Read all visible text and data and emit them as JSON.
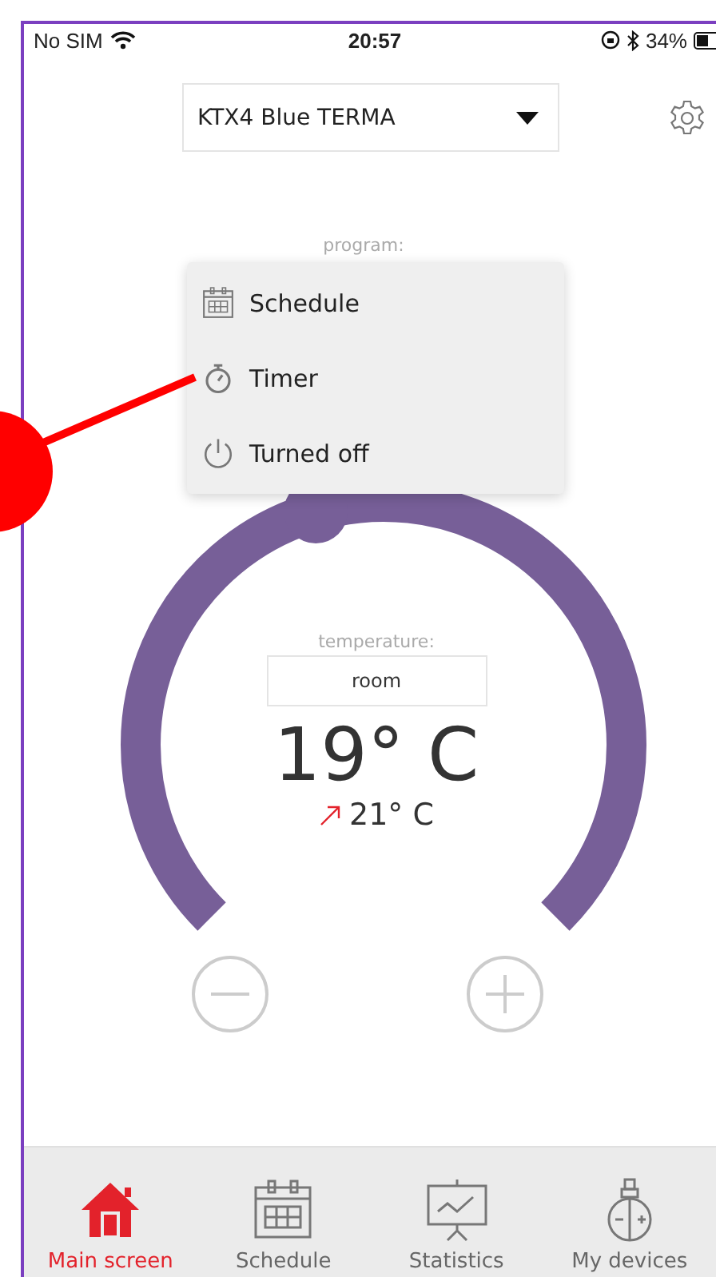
{
  "status_bar": {
    "carrier": "No SIM",
    "time": "20:57",
    "battery": "34%"
  },
  "device_select": {
    "value": "KTX4 Blue TERMA"
  },
  "program": {
    "label": "program:",
    "menu": [
      {
        "label": "Schedule",
        "kind": "schedule"
      },
      {
        "label": "Timer",
        "kind": "timer"
      },
      {
        "label": "Turned off",
        "kind": "off"
      }
    ]
  },
  "temperature": {
    "label": "temperature:",
    "mode": "room",
    "setpoint": "19° C",
    "current": "21° C"
  },
  "nav": [
    {
      "label": "Main screen",
      "kind": "home",
      "selected": true
    },
    {
      "label": "Schedule",
      "kind": "schedule",
      "selected": false
    },
    {
      "label": "Statistics",
      "kind": "statistics",
      "selected": false
    },
    {
      "label": "My devices",
      "kind": "devices",
      "selected": false
    }
  ]
}
